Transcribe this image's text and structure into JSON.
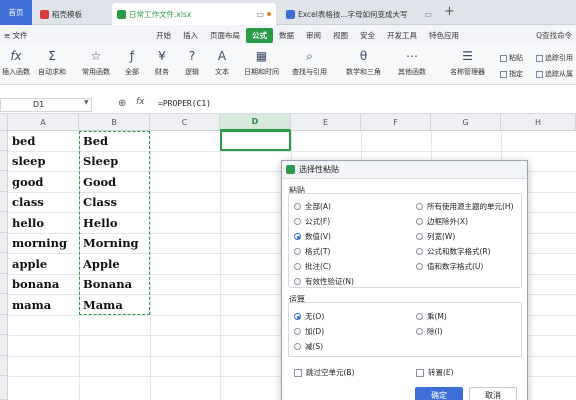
{
  "tabs": [
    {
      "label": "首页",
      "color": "#3d6fd6"
    },
    {
      "label": "稻壳模板",
      "color": "#d83b3b"
    },
    {
      "label": "日常工作文件.xlsx",
      "color": "#2b9b48"
    },
    {
      "label": "Excel表格技...字母如何变成大写",
      "color": "#3d6fd6"
    }
  ],
  "menu": {
    "hamburger": "≡ 文件",
    "items": [
      "开始",
      "插入",
      "页面布局",
      "公式",
      "数据",
      "审阅",
      "视图",
      "安全",
      "开发工具",
      "特色应用"
    ],
    "active": "公式",
    "search": "Q查找命令"
  },
  "ribbon": {
    "buttons": [
      "插入函数",
      "自动求和",
      "常用函数",
      "全部",
      "财务",
      "逻辑",
      "文本",
      "日期和时间",
      "查找与引用",
      "数学和三角",
      "其他函数",
      "名称管理器"
    ],
    "small": [
      "粘贴",
      "指定",
      "追踪引用",
      "追踪从属"
    ]
  },
  "formula_bar": {
    "name": "D1",
    "formula": "=PROPER(C1)"
  },
  "columns": [
    "A",
    "B",
    "C",
    "D",
    "E",
    "F",
    "G",
    "H"
  ],
  "selected_column": "D",
  "col_a": [
    "bed",
    "sleep",
    "good",
    "class",
    "hello",
    "morning",
    "apple",
    "bonana",
    "mama"
  ],
  "col_b": [
    "Bed",
    "Sleep",
    "Good",
    "Class",
    "Hello",
    "Morning",
    "Apple",
    "Bonana",
    "Mama"
  ],
  "dialog": {
    "title": "选择性粘贴",
    "paste_label": "粘贴",
    "paste_options_left": [
      "全部(A)",
      "公式(F)",
      "数值(V)",
      "格式(T)",
      "批注(C)",
      "有效性验证(N)"
    ],
    "paste_options_right": [
      "所有使用源主题的单元(H)",
      "边框除外(X)",
      "列宽(W)",
      "公式和数字格式(R)",
      "值和数字格式(U)"
    ],
    "paste_selected": "数值(V)",
    "operation_label": "运算",
    "operation_left": [
      "无(O)",
      "加(D)",
      "减(S)"
    ],
    "operation_right": [
      "乘(M)",
      "除(I)"
    ],
    "operation_selected": "无(O)",
    "skip_blanks": "跳过空单元(B)",
    "transpose": "转置(E)",
    "ok": "确定",
    "cancel": "取消"
  }
}
